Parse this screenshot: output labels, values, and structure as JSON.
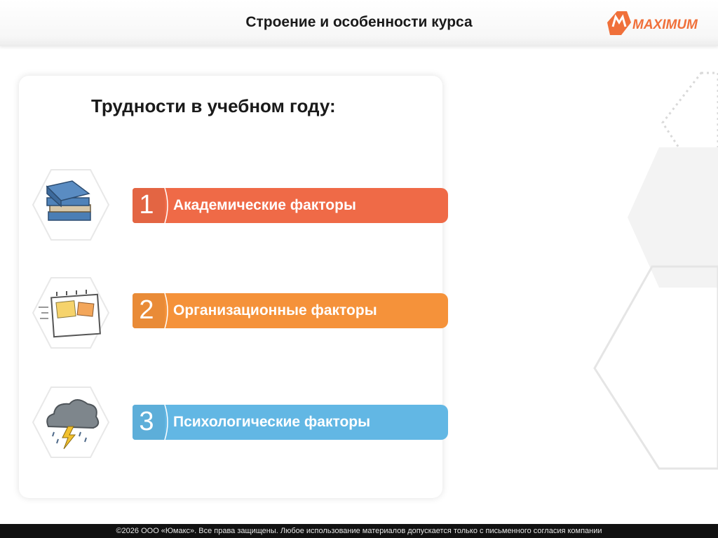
{
  "header": {
    "title": "Строение и особенности курса",
    "logo_text": "MAXIMUM",
    "logo_color": "#f0703a"
  },
  "card": {
    "heading": "Трудности в учебном году:"
  },
  "factors": [
    {
      "number": "1",
      "label": "Академические факторы",
      "color": "#ef6a47",
      "icon": "books-icon"
    },
    {
      "number": "2",
      "label": "Организационные факторы",
      "color": "#f5923a",
      "icon": "calendar-icon"
    },
    {
      "number": "3",
      "label": "Психологические факторы",
      "color": "#62b7e4",
      "icon": "storm-cloud-icon"
    }
  ],
  "footer": {
    "text": "©2026 ООО «Юмакс». Все права защищены. Любое использование материалов допускается только с письменного согласия компании"
  }
}
